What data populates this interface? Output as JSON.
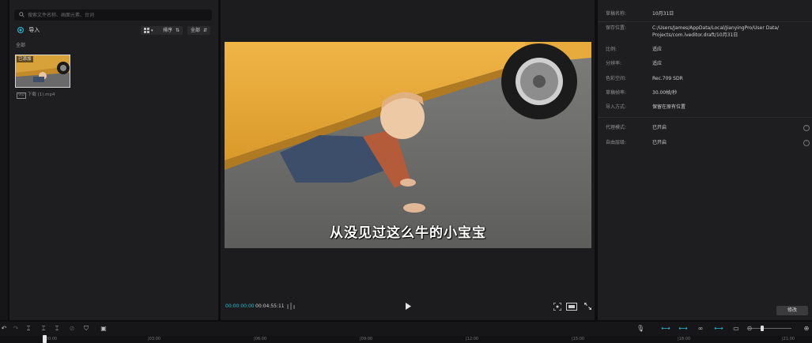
{
  "media": {
    "search_placeholder": "搜索文件名称、画面元素、台词",
    "import_label": "导入",
    "sort_label": "排序",
    "filter_label": "全部",
    "all_label": "全部",
    "added_badge": "已添加",
    "file_tag": "VID",
    "file_name": "下载 (1).mp4"
  },
  "player": {
    "subtitle": "从没见过这么牛的小宝宝",
    "time_current": "00:00:00:00",
    "time_total": "00:04:55:11"
  },
  "details": {
    "rows": [
      {
        "label": "草稿名称:",
        "value": "10月31日"
      },
      {
        "label": "保存位置:",
        "value": "C:/Users/James/AppData/Local/JianyingPro/User Data/"
      },
      {
        "label": "",
        "value": "Projects/com.lveditor.draft/10月31日"
      },
      {
        "label": "比例:",
        "value": "适应"
      },
      {
        "label": "分辨率:",
        "value": "适应"
      },
      {
        "label": "色彩空间:",
        "value": "Rec.709 SDR"
      },
      {
        "label": "草稿帧率:",
        "value": "30.00帧/秒"
      },
      {
        "label": "导入方式:",
        "value": "保留在原有位置"
      },
      {
        "label": "代理模式:",
        "value": "已开启"
      },
      {
        "label": "自由层级:",
        "value": "已开启"
      }
    ],
    "modify_label": "修改"
  },
  "timeline": {
    "ticks": [
      "|00:00",
      "|03:00",
      "|06:00",
      "|09:00",
      "|12:00",
      "|15:00",
      "|18:00",
      "|21:00"
    ]
  },
  "colors": {
    "accent": "#2bbbd3",
    "panel": "#1e1e20",
    "background": "#0d0d0f"
  }
}
